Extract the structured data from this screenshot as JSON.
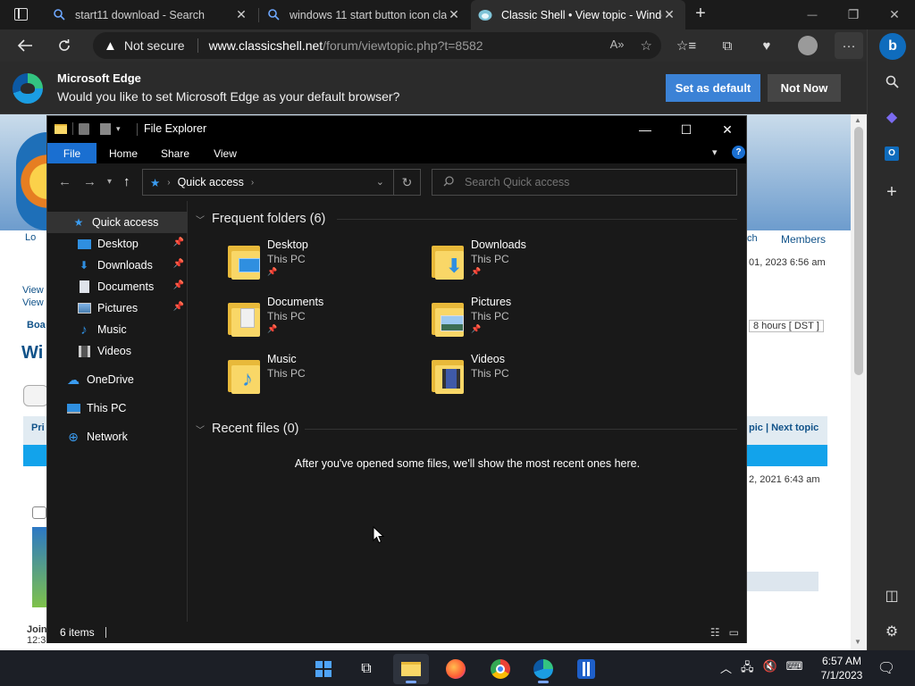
{
  "browser": {
    "tabs": [
      {
        "title": "start11 download - Search",
        "icon": "search-icon",
        "close": "✕"
      },
      {
        "title": "windows 11 start button icon cla",
        "icon": "search-icon",
        "close": "✕"
      },
      {
        "title": "Classic Shell • View topic - Windo",
        "icon": "classic-shell-icon",
        "close": "✕",
        "active": true
      }
    ],
    "new_tab": "+",
    "window_controls": {
      "minimize": "—",
      "restore": "❐",
      "close": "✕"
    },
    "address": {
      "security_text": "Not secure",
      "domain": "www.classicshell.net",
      "path": "/forum/viewtopic.php?t=8582"
    },
    "infobar": {
      "title": "Microsoft Edge",
      "message": "Would you like to set Microsoft Edge as your default browser?",
      "primary_button": "Set as default",
      "secondary_button": "Not Now"
    }
  },
  "webpage": {
    "members": "Members",
    "ch": "ch",
    "date_top": "01, 2023 6:56 am",
    "hours": "8 hours [ DST ]",
    "topic_nav": "pic | Next topic",
    "date_bottom": "2, 2021 6:43 am",
    "view1": "View",
    "view2": "View",
    "boa": "Boa",
    "wi": "Wi",
    "pri": "Pri",
    "join": "Join",
    "time_left": "12:3",
    "lo": "Lo"
  },
  "explorer": {
    "title": "File Explorer",
    "ribbon_tabs": [
      "File",
      "Home",
      "Share",
      "View"
    ],
    "help": "?",
    "path": "Quick access",
    "search_placeholder": "Search Quick access",
    "nav": [
      {
        "label": "Quick access",
        "icon": "star-icon",
        "selected": true
      },
      {
        "label": "Desktop",
        "icon": "desktop-icon",
        "pinned": true
      },
      {
        "label": "Downloads",
        "icon": "downloads-icon",
        "pinned": true
      },
      {
        "label": "Documents",
        "icon": "documents-icon",
        "pinned": true
      },
      {
        "label": "Pictures",
        "icon": "pictures-icon",
        "pinned": true
      },
      {
        "label": "Music",
        "icon": "music-icon"
      },
      {
        "label": "Videos",
        "icon": "videos-icon"
      },
      {
        "label": "OneDrive",
        "icon": "onedrive-icon"
      },
      {
        "label": "This PC",
        "icon": "this-pc-icon"
      },
      {
        "label": "Network",
        "icon": "network-icon"
      }
    ],
    "frequent_header": "Frequent folders (6)",
    "folders": [
      {
        "name": "Desktop",
        "location": "This PC",
        "pinned": true,
        "overlay": "desktop-icon"
      },
      {
        "name": "Downloads",
        "location": "This PC",
        "pinned": true,
        "overlay": "downloads-icon"
      },
      {
        "name": "Documents",
        "location": "This PC",
        "pinned": true,
        "overlay": "documents-icon"
      },
      {
        "name": "Pictures",
        "location": "This PC",
        "pinned": true,
        "overlay": "pictures-icon"
      },
      {
        "name": "Music",
        "location": "This PC",
        "pinned": false,
        "overlay": "music-icon"
      },
      {
        "name": "Videos",
        "location": "This PC",
        "pinned": false,
        "overlay": "videos-icon"
      }
    ],
    "recent_header": "Recent files (0)",
    "recent_empty": "After you've opened some files, we'll show the most recent ones here.",
    "status": "6 items"
  },
  "taskbar": {
    "time": "6:57 AM",
    "date": "7/1/2023"
  },
  "colors": {
    "accent": "#1a6fd1",
    "edge_button": "#3b82d6",
    "folder": "#f9d767"
  }
}
